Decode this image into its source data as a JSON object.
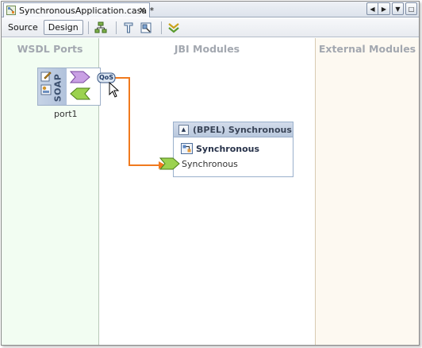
{
  "tab": {
    "title": "SynchronousApplication.casa *",
    "icon": "casa-file-icon",
    "close": "×"
  },
  "nav": {
    "left": "◀",
    "right": "▶",
    "dropdown": "▼",
    "maximize": "□"
  },
  "toolbar": {
    "source_label": "Source",
    "design_label": "Design"
  },
  "columns": {
    "wsdl_ports": "WSDL Ports",
    "jbi_modules": "JBI Modules",
    "external_modules": "External Modules"
  },
  "port": {
    "binding": "SOAP",
    "name": "port1",
    "qos": "QoS"
  },
  "bpel_module": {
    "title": "(BPEL) Synchronous",
    "collapse": "▲",
    "process_name": "Synchronous",
    "endpoint_name": "Synchronous"
  },
  "colors": {
    "connection": "#f07a1e",
    "provide_arrow": "#b486d4",
    "consume_arrow": "#8bc640",
    "wsdl_bg": "#f2fdf2",
    "external_bg": "#fdf9f1"
  }
}
